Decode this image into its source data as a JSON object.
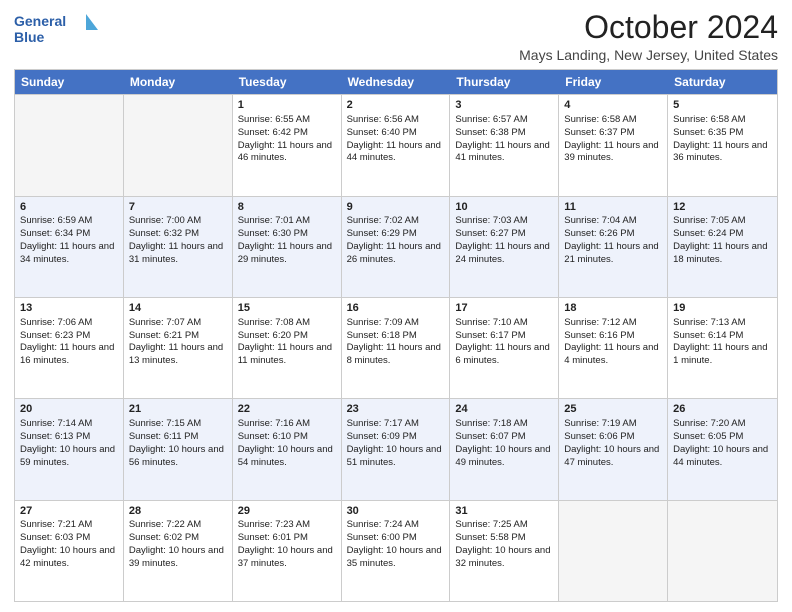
{
  "logo": {
    "line1": "General",
    "line2": "Blue"
  },
  "title": "October 2024",
  "location": "Mays Landing, New Jersey, United States",
  "days_of_week": [
    "Sunday",
    "Monday",
    "Tuesday",
    "Wednesday",
    "Thursday",
    "Friday",
    "Saturday"
  ],
  "weeks": [
    [
      {
        "day": "",
        "sunrise": "",
        "sunset": "",
        "daylight": "",
        "empty": true
      },
      {
        "day": "",
        "sunrise": "",
        "sunset": "",
        "daylight": "",
        "empty": true
      },
      {
        "day": "1",
        "sunrise": "Sunrise: 6:55 AM",
        "sunset": "Sunset: 6:42 PM",
        "daylight": "Daylight: 11 hours and 46 minutes."
      },
      {
        "day": "2",
        "sunrise": "Sunrise: 6:56 AM",
        "sunset": "Sunset: 6:40 PM",
        "daylight": "Daylight: 11 hours and 44 minutes."
      },
      {
        "day": "3",
        "sunrise": "Sunrise: 6:57 AM",
        "sunset": "Sunset: 6:38 PM",
        "daylight": "Daylight: 11 hours and 41 minutes."
      },
      {
        "day": "4",
        "sunrise": "Sunrise: 6:58 AM",
        "sunset": "Sunset: 6:37 PM",
        "daylight": "Daylight: 11 hours and 39 minutes."
      },
      {
        "day": "5",
        "sunrise": "Sunrise: 6:58 AM",
        "sunset": "Sunset: 6:35 PM",
        "daylight": "Daylight: 11 hours and 36 minutes."
      }
    ],
    [
      {
        "day": "6",
        "sunrise": "Sunrise: 6:59 AM",
        "sunset": "Sunset: 6:34 PM",
        "daylight": "Daylight: 11 hours and 34 minutes."
      },
      {
        "day": "7",
        "sunrise": "Sunrise: 7:00 AM",
        "sunset": "Sunset: 6:32 PM",
        "daylight": "Daylight: 11 hours and 31 minutes."
      },
      {
        "day": "8",
        "sunrise": "Sunrise: 7:01 AM",
        "sunset": "Sunset: 6:30 PM",
        "daylight": "Daylight: 11 hours and 29 minutes."
      },
      {
        "day": "9",
        "sunrise": "Sunrise: 7:02 AM",
        "sunset": "Sunset: 6:29 PM",
        "daylight": "Daylight: 11 hours and 26 minutes."
      },
      {
        "day": "10",
        "sunrise": "Sunrise: 7:03 AM",
        "sunset": "Sunset: 6:27 PM",
        "daylight": "Daylight: 11 hours and 24 minutes."
      },
      {
        "day": "11",
        "sunrise": "Sunrise: 7:04 AM",
        "sunset": "Sunset: 6:26 PM",
        "daylight": "Daylight: 11 hours and 21 minutes."
      },
      {
        "day": "12",
        "sunrise": "Sunrise: 7:05 AM",
        "sunset": "Sunset: 6:24 PM",
        "daylight": "Daylight: 11 hours and 18 minutes."
      }
    ],
    [
      {
        "day": "13",
        "sunrise": "Sunrise: 7:06 AM",
        "sunset": "Sunset: 6:23 PM",
        "daylight": "Daylight: 11 hours and 16 minutes."
      },
      {
        "day": "14",
        "sunrise": "Sunrise: 7:07 AM",
        "sunset": "Sunset: 6:21 PM",
        "daylight": "Daylight: 11 hours and 13 minutes."
      },
      {
        "day": "15",
        "sunrise": "Sunrise: 7:08 AM",
        "sunset": "Sunset: 6:20 PM",
        "daylight": "Daylight: 11 hours and 11 minutes."
      },
      {
        "day": "16",
        "sunrise": "Sunrise: 7:09 AM",
        "sunset": "Sunset: 6:18 PM",
        "daylight": "Daylight: 11 hours and 8 minutes."
      },
      {
        "day": "17",
        "sunrise": "Sunrise: 7:10 AM",
        "sunset": "Sunset: 6:17 PM",
        "daylight": "Daylight: 11 hours and 6 minutes."
      },
      {
        "day": "18",
        "sunrise": "Sunrise: 7:12 AM",
        "sunset": "Sunset: 6:16 PM",
        "daylight": "Daylight: 11 hours and 4 minutes."
      },
      {
        "day": "19",
        "sunrise": "Sunrise: 7:13 AM",
        "sunset": "Sunset: 6:14 PM",
        "daylight": "Daylight: 11 hours and 1 minute."
      }
    ],
    [
      {
        "day": "20",
        "sunrise": "Sunrise: 7:14 AM",
        "sunset": "Sunset: 6:13 PM",
        "daylight": "Daylight: 10 hours and 59 minutes."
      },
      {
        "day": "21",
        "sunrise": "Sunrise: 7:15 AM",
        "sunset": "Sunset: 6:11 PM",
        "daylight": "Daylight: 10 hours and 56 minutes."
      },
      {
        "day": "22",
        "sunrise": "Sunrise: 7:16 AM",
        "sunset": "Sunset: 6:10 PM",
        "daylight": "Daylight: 10 hours and 54 minutes."
      },
      {
        "day": "23",
        "sunrise": "Sunrise: 7:17 AM",
        "sunset": "Sunset: 6:09 PM",
        "daylight": "Daylight: 10 hours and 51 minutes."
      },
      {
        "day": "24",
        "sunrise": "Sunrise: 7:18 AM",
        "sunset": "Sunset: 6:07 PM",
        "daylight": "Daylight: 10 hours and 49 minutes."
      },
      {
        "day": "25",
        "sunrise": "Sunrise: 7:19 AM",
        "sunset": "Sunset: 6:06 PM",
        "daylight": "Daylight: 10 hours and 47 minutes."
      },
      {
        "day": "26",
        "sunrise": "Sunrise: 7:20 AM",
        "sunset": "Sunset: 6:05 PM",
        "daylight": "Daylight: 10 hours and 44 minutes."
      }
    ],
    [
      {
        "day": "27",
        "sunrise": "Sunrise: 7:21 AM",
        "sunset": "Sunset: 6:03 PM",
        "daylight": "Daylight: 10 hours and 42 minutes."
      },
      {
        "day": "28",
        "sunrise": "Sunrise: 7:22 AM",
        "sunset": "Sunset: 6:02 PM",
        "daylight": "Daylight: 10 hours and 39 minutes."
      },
      {
        "day": "29",
        "sunrise": "Sunrise: 7:23 AM",
        "sunset": "Sunset: 6:01 PM",
        "daylight": "Daylight: 10 hours and 37 minutes."
      },
      {
        "day": "30",
        "sunrise": "Sunrise: 7:24 AM",
        "sunset": "Sunset: 6:00 PM",
        "daylight": "Daylight: 10 hours and 35 minutes."
      },
      {
        "day": "31",
        "sunrise": "Sunrise: 7:25 AM",
        "sunset": "Sunset: 5:58 PM",
        "daylight": "Daylight: 10 hours and 32 minutes."
      },
      {
        "day": "",
        "sunrise": "",
        "sunset": "",
        "daylight": "",
        "empty": true
      },
      {
        "day": "",
        "sunrise": "",
        "sunset": "",
        "daylight": "",
        "empty": true
      }
    ]
  ]
}
